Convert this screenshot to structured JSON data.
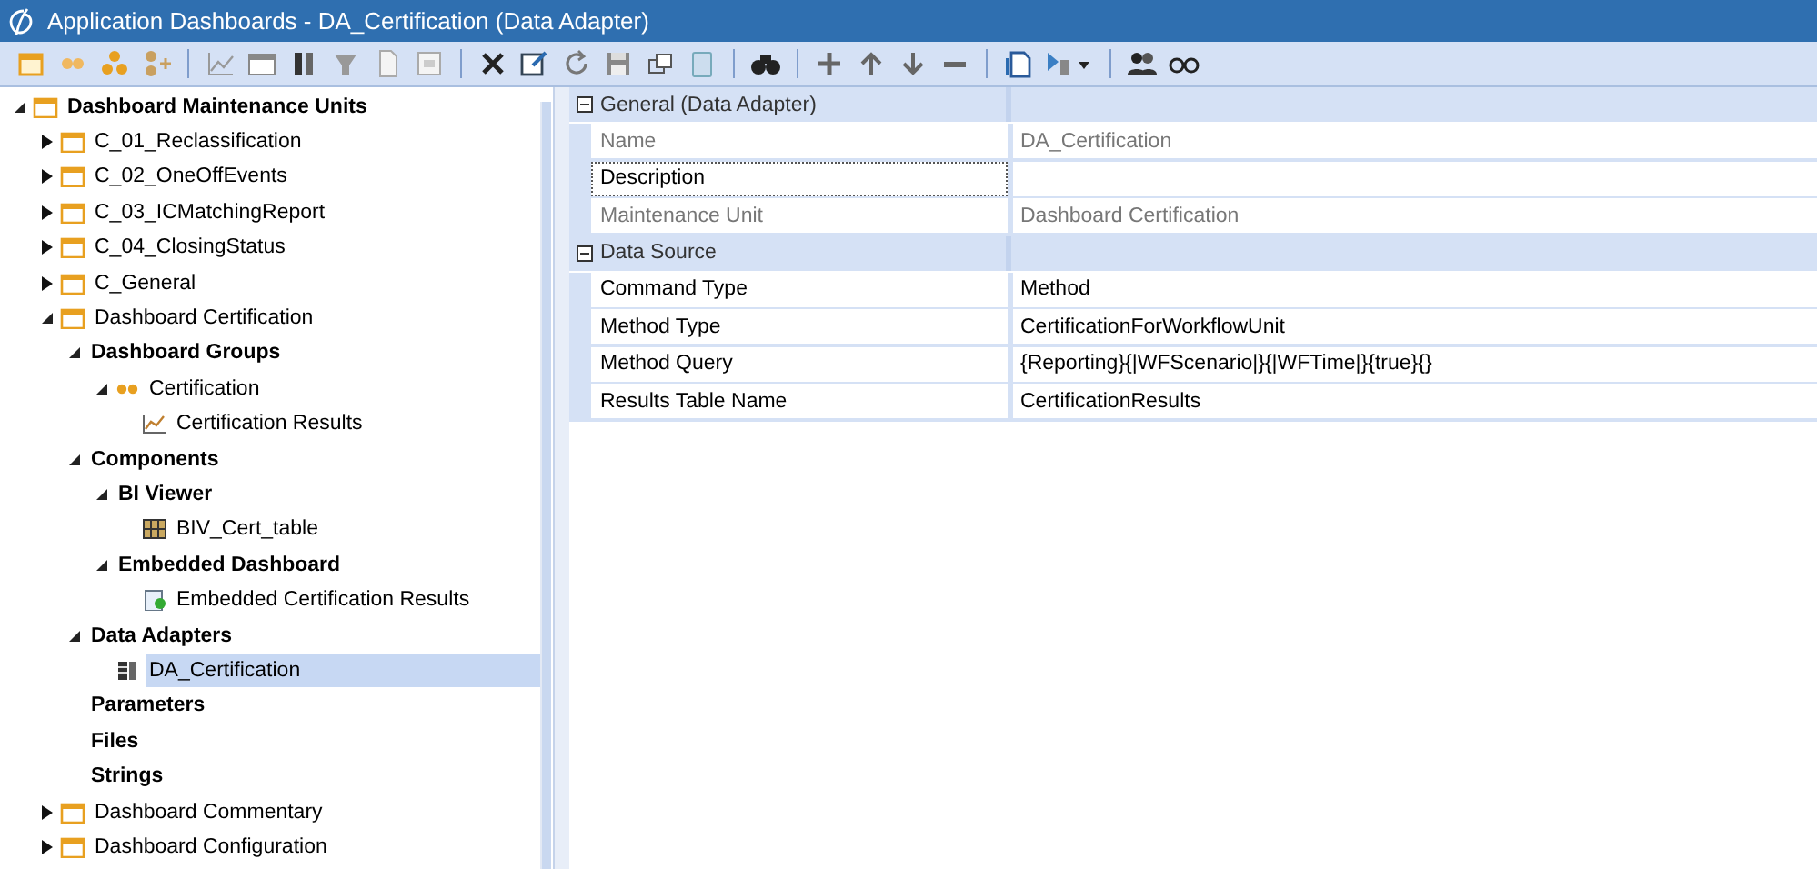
{
  "window": {
    "title": "Application Dashboards - DA_Certification (Data Adapter)"
  },
  "tree": [
    {
      "label": "Dashboard Maintenance Units",
      "kind": "unit",
      "bold": true,
      "expanded": true,
      "selected": false,
      "children": [
        {
          "label": "C_01_Reclassification",
          "kind": "unit",
          "bold": false,
          "expanded": false,
          "selected": false
        },
        {
          "label": "C_02_OneOffEvents",
          "kind": "unit",
          "bold": false,
          "expanded": false,
          "selected": false
        },
        {
          "label": "C_03_ICMatchingReport",
          "kind": "unit",
          "bold": false,
          "expanded": false,
          "selected": false
        },
        {
          "label": "C_04_ClosingStatus",
          "kind": "unit",
          "bold": false,
          "expanded": false,
          "selected": false
        },
        {
          "label": "C_General",
          "kind": "unit",
          "bold": false,
          "expanded": false,
          "selected": false
        },
        {
          "label": "Dashboard Certification",
          "kind": "unit",
          "bold": false,
          "expanded": true,
          "selected": false,
          "children": [
            {
              "label": "Dashboard Groups",
              "bold": true,
              "expanded": true,
              "selected": false,
              "children": [
                {
                  "label": "Certification",
                  "kind": "group",
                  "bold": false,
                  "expanded": true,
                  "selected": false,
                  "children": [
                    {
                      "label": "Certification Results",
                      "kind": "chart",
                      "bold": false,
                      "selected": false
                    }
                  ]
                }
              ]
            },
            {
              "label": "Components",
              "bold": true,
              "expanded": true,
              "selected": false,
              "children": [
                {
                  "label": "BI Viewer",
                  "bold": true,
                  "expanded": true,
                  "selected": false,
                  "children": [
                    {
                      "label": "BIV_Cert_table",
                      "kind": "grid",
                      "bold": false,
                      "selected": false
                    }
                  ]
                },
                {
                  "label": "Embedded Dashboard",
                  "bold": true,
                  "expanded": true,
                  "selected": false,
                  "children": [
                    {
                      "label": "Embedded Certification Results",
                      "kind": "embedded",
                      "bold": false,
                      "selected": false
                    }
                  ]
                }
              ]
            },
            {
              "label": "Data Adapters",
              "bold": true,
              "expanded": true,
              "selected": false,
              "children": [
                {
                  "label": "DA_Certification",
                  "kind": "adapter",
                  "bold": false,
                  "selected": true
                }
              ]
            },
            {
              "label": "Parameters",
              "bold": true,
              "selected": false
            },
            {
              "label": "Files",
              "bold": true,
              "selected": false
            },
            {
              "label": "Strings",
              "bold": true,
              "selected": false
            }
          ]
        },
        {
          "label": "Dashboard Commentary",
          "kind": "unit",
          "bold": false,
          "expanded": false,
          "selected": false
        },
        {
          "label": "Dashboard Configuration",
          "kind": "unit",
          "bold": false,
          "expanded": false,
          "selected": false
        }
      ]
    }
  ],
  "properties": [
    {
      "category": "General (Data Adapter)",
      "expanded": true,
      "rows": [
        {
          "label": "Name",
          "value": "DA_Certification",
          "readonly": true,
          "focused": false
        },
        {
          "label": "Description",
          "readonly": false,
          "focused": true
        },
        {
          "label": "Maintenance Unit",
          "value": "Dashboard Certification",
          "readonly": true,
          "focused": false
        }
      ]
    },
    {
      "category": "Data Source",
      "expanded": true,
      "rows": [
        {
          "label": "Command Type",
          "value": "Method",
          "readonly": false,
          "focused": false
        },
        {
          "label": "Method Type",
          "value": "CertificationForWorkflowUnit",
          "readonly": false,
          "focused": false
        },
        {
          "label": "Method Query",
          "value": "{Reporting}{|WFScenario|}{|WFTime|}{true}{}",
          "readonly": false,
          "focused": false
        },
        {
          "label": "Results Table Name",
          "value": "CertificationResults",
          "readonly": false,
          "focused": false
        }
      ]
    }
  ]
}
